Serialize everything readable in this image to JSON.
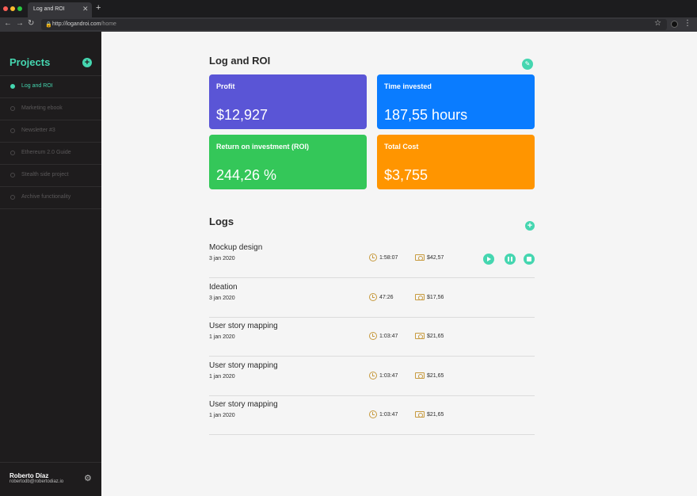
{
  "browser": {
    "tab_title": "Log and ROI",
    "tab_close": "✕",
    "new_tab": "+",
    "url_host": "http://logandroi.com",
    "url_path": "/home",
    "back_glyph": "←",
    "forward_glyph": "→",
    "reload_glyph": "↻",
    "lock_glyph": "🔒",
    "star_glyph": "☆",
    "menu_glyph": "⋮"
  },
  "sidebar": {
    "title": "Projects",
    "add_glyph": "+",
    "items": [
      {
        "label": "Log and ROI",
        "active": true
      },
      {
        "label": "Marketing ebook",
        "active": false
      },
      {
        "label": "Newsletter #3",
        "active": false
      },
      {
        "label": "Ethereum 2.0 Guide",
        "active": false
      },
      {
        "label": "Stealth side project",
        "active": false
      },
      {
        "label": "Archive functionality",
        "active": false
      }
    ],
    "user": {
      "name": "Roberto Díaz",
      "email": "robertodb@robertodiaz.io"
    },
    "gear_glyph": "⚙"
  },
  "main": {
    "title": "Log and ROI",
    "edit_glyph": "✎",
    "cards": {
      "profit": {
        "label": "Profit",
        "value": "$12,927",
        "color": "#5a55d6"
      },
      "time": {
        "label": "Time invested",
        "value": "187,55 hours",
        "color": "#0a7cff"
      },
      "roi": {
        "label": "Return  on investment (ROI)",
        "value": "244,26 %",
        "color": "#34c759"
      },
      "cost": {
        "label": "Total Cost",
        "value": "$3,755",
        "color": "#ff9500"
      }
    },
    "logs_title": "Logs",
    "add_log_glyph": "+",
    "logs": [
      {
        "name": "Mockup design",
        "date": "3 jan 2020",
        "duration": "1:58:07",
        "cost": "$42,57"
      },
      {
        "name": "Ideation",
        "date": "3 jan 2020",
        "duration": "47:26",
        "cost": "$17,56"
      },
      {
        "name": "User story mapping",
        "date": "1 jan 2020",
        "duration": "1:03:47",
        "cost": "$21,65"
      },
      {
        "name": "User story mapping",
        "date": "1 jan 2020",
        "duration": "1:03:47",
        "cost": "$21,65"
      },
      {
        "name": "User story mapping",
        "date": "1 jan 2020",
        "duration": "1:03:47",
        "cost": "$21,65"
      }
    ]
  },
  "colors": {
    "accent": "#45d6b0",
    "sidebar_bg": "#1e1c1d",
    "page_bg": "#f5f5f5",
    "icon_gold": "#c79a3e"
  }
}
